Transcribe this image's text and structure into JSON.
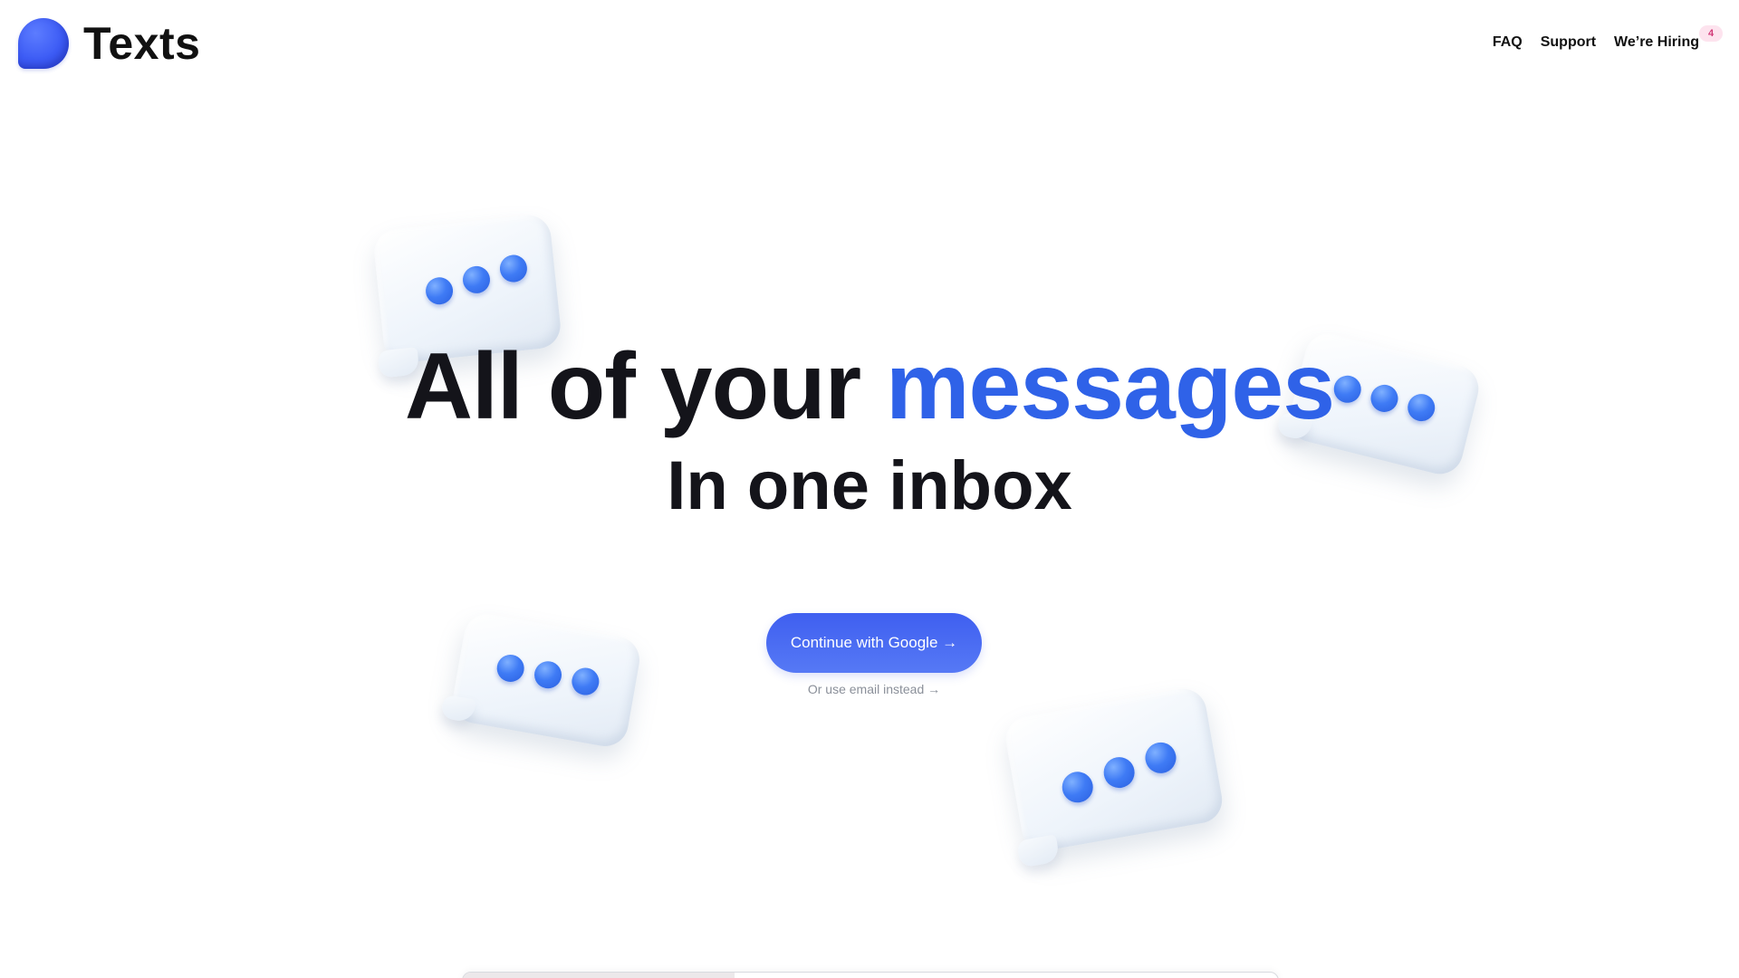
{
  "header": {
    "logo_text": "Texts",
    "nav": [
      {
        "label": "FAQ"
      },
      {
        "label": "Support"
      },
      {
        "label": "We’re Hiring",
        "badge": "4"
      }
    ]
  },
  "hero": {
    "title_prefix": "All of your ",
    "title_accent": "messages",
    "subtitle": "In one inbox",
    "cta_label": "Continue with Google →",
    "alt_link": "Or use email instead →"
  },
  "colors": {
    "accent": "#2f62e8",
    "cta": "#4766f2",
    "badge_bg": "#fde3ee",
    "badge_text": "#d23a78"
  },
  "icons": {
    "logo": "blue-speech-bubble-logo",
    "decorations": [
      "typing-bubble-icon",
      "typing-bubble-icon",
      "typing-bubble-icon",
      "typing-bubble-icon"
    ]
  }
}
